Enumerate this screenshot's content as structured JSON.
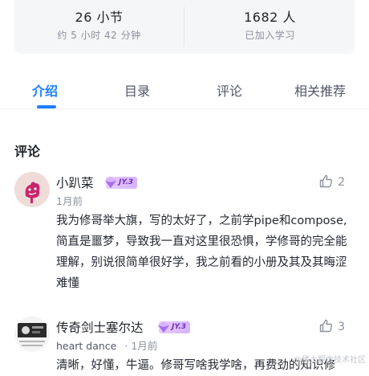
{
  "stats": {
    "sections": {
      "value": "26 小节",
      "label": "约 5 小时 42 分钟"
    },
    "learners": {
      "value": "1682 人",
      "label": "已加入学习"
    }
  },
  "tabs": [
    {
      "label": "介绍",
      "active": true
    },
    {
      "label": "目录",
      "active": false
    },
    {
      "label": "评论",
      "active": false
    },
    {
      "label": "相关推荐",
      "active": false
    }
  ],
  "section_title": "评论",
  "comments": [
    {
      "username": "小趴菜",
      "badge": "JY.3",
      "title": "",
      "time": "1月前",
      "likes": "2",
      "content": "我为修哥举大旗，写的太好了，之前学pipe和compose,简直是噩梦，导致我一直对这里很恐惧，学修哥的完全能理解，别说很简单很好学，我之前看的小册及其及其晦涩难懂"
    },
    {
      "username": "传奇剑士塞尔达",
      "badge": "JY.3",
      "title": "heart dance",
      "time": "1月前",
      "likes": "3",
      "content": "清晰，好懂，牛逼。修哥写啥我学啥，再费劲的知识修"
    }
  ],
  "watermark": "@稀土掘金技术社区",
  "colors": {
    "accent": "#1e80ff",
    "badge": "#d6b3ff"
  }
}
